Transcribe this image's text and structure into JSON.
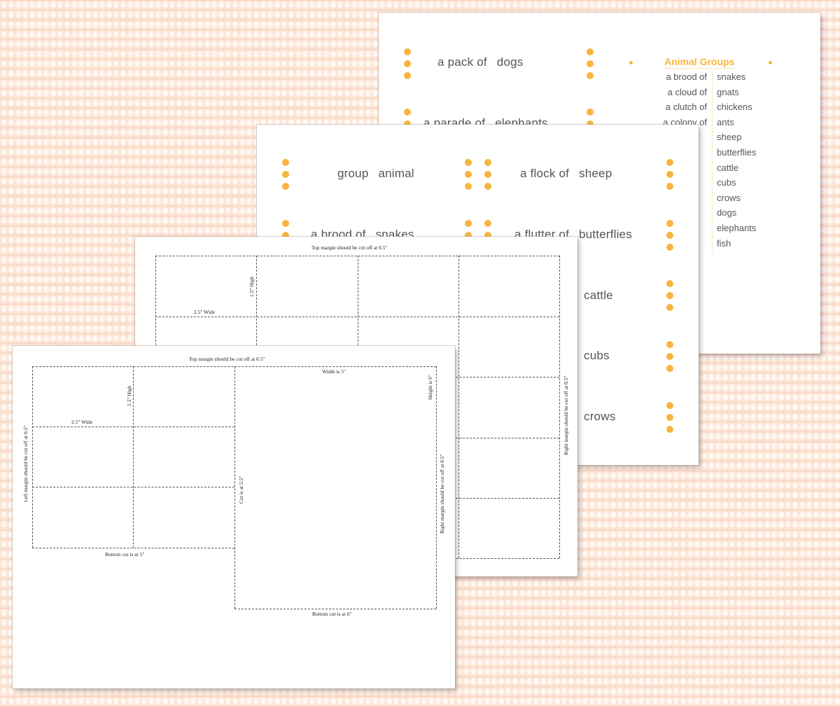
{
  "background": {
    "color": "#fbe2d2",
    "texture": "woven fabric"
  },
  "accent_color": "#f7b53f",
  "text_color": "#55545b",
  "page1": {
    "cards": [
      {
        "group": "a pack of",
        "animal": "dogs"
      },
      {
        "group": "a parade of",
        "animal": "elephants"
      }
    ],
    "animal_groups": {
      "title": "Animal Groups",
      "rows": [
        {
          "group": "a brood of",
          "animal": "snakes"
        },
        {
          "group": "a cloud of",
          "animal": "gnats"
        },
        {
          "group": "a clutch of",
          "animal": "chickens"
        },
        {
          "group": "a colony of",
          "animal": "ants"
        },
        {
          "group": "",
          "animal": "sheep"
        },
        {
          "group": "",
          "animal": "butterflies"
        },
        {
          "group": "",
          "animal": "cattle"
        },
        {
          "group": "",
          "animal": "cubs"
        },
        {
          "group": "",
          "animal": "crows"
        },
        {
          "group": "",
          "animal": "dogs"
        },
        {
          "group": "",
          "animal": "elephants"
        },
        {
          "group": "",
          "animal": "fish"
        }
      ]
    }
  },
  "page2": {
    "cards": [
      {
        "group": "group",
        "animal": "animal"
      },
      {
        "group": "a flock of",
        "animal": "sheep"
      },
      {
        "group": "a brood of",
        "animal": "snakes"
      },
      {
        "group": "a flutter of",
        "animal": "butterflies"
      },
      {
        "group": "",
        "animal": "cattle"
      },
      {
        "group": "",
        "animal": "cubs"
      },
      {
        "group": "",
        "animal": "crows"
      }
    ]
  },
  "page3": {
    "top_label": "Top margin should be cut off at 0.5\"",
    "height_label": "1.5\" High",
    "width_label": "2.5\" Wide",
    "right_label": "Right margin should be cut off at 0.5\""
  },
  "page4": {
    "top_label": "Top margin should be cut off at 0.5\"",
    "height_label": "1.5\" High",
    "width_label": "2.5\" Wide",
    "left_label": "Left margin should be cut off at 0.5\"",
    "cut_label": "Cut is at 5.5\"",
    "bottom_left_label": "Bottom cut is at 5\"",
    "big_width_label": "Width is 5\"",
    "big_height_label": "Height is 6\"",
    "right_label": "Right margin should be cut off at 0.5\"",
    "bottom_right_label": "Bottom cut is at 6\""
  }
}
